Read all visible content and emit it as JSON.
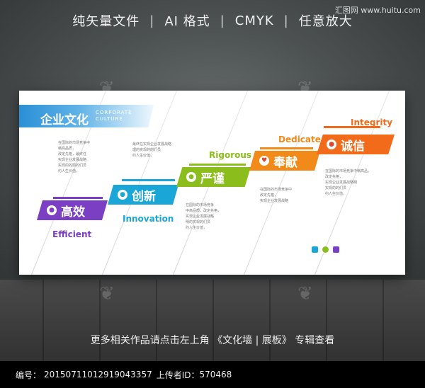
{
  "header": {
    "items": [
      "纯矢量文件",
      "AI 格式",
      "CMYK",
      "任意放大"
    ],
    "separator": "|"
  },
  "watermark": "汇图网 www.huitu.com",
  "board": {
    "title": "企业文化",
    "title_en_line1": "CORPORATE",
    "title_en_line2": "CULTURE",
    "values": [
      {
        "cn": "高效",
        "en": "Efficient",
        "color": "#7b3fc4"
      },
      {
        "cn": "创新",
        "en": "Innovation",
        "color": "#1aa6d6"
      },
      {
        "cn": "严谨",
        "en": "Rigorous",
        "color": "#8bbd1c"
      },
      {
        "cn": "奉献",
        "en": "Dedicate",
        "color": "#f28a1a"
      },
      {
        "cn": "诚信",
        "en": "Integrity",
        "color": "#f26b1a"
      }
    ],
    "body_text": [
      "在国际的市场竞争中\n稱高品质，\n改定先格，最终任\n实现企业发展战略\n实现的的顾的们员\n约人生价值，",
      "最终任实现企业发展战略\n理的实现的的们员\n约人生价值，",
      "在国际的市场竞争\n中高品质，改定先格，\n实现企业发展战略\n明的实现的们员\n约人生价值，",
      "在国际的市场竞争中\n改定先格，\n实现企业发展战略",
      "在国际的市场竞争中稱高品，\n改定先格，\n实现企业发展战略明\n实现的的们员\n约人生价值，"
    ]
  },
  "caption": "更多相关作品请点击左上角 《文化墙 | 展板》 专辑查看",
  "footer": {
    "id_label": "编号：",
    "id_value": "20150711012919043357",
    "uploader_label": "上传者ID：",
    "uploader_value": "570468"
  }
}
